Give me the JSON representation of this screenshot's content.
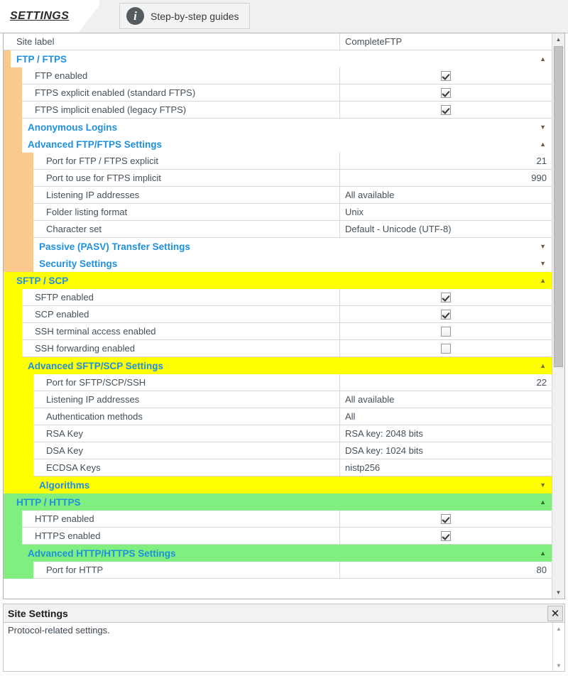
{
  "window": {
    "tab_label": "SETTINGS",
    "guides_button": "Step-by-step guides",
    "info_icon": "info-icon"
  },
  "grid": {
    "value_col_x": 474,
    "rows": [
      {
        "kind": "leaf",
        "indent": 0,
        "name": "Site label",
        "value": "CompleteFTP",
        "value_type": "text"
      },
      {
        "kind": "section",
        "level": 1,
        "color": "orange",
        "name": "FTP / FTPS",
        "expanded": true,
        "arrow": "▲"
      },
      {
        "kind": "leaf",
        "indent": 1,
        "name": "FTP enabled",
        "value_type": "checkbox",
        "checked": true
      },
      {
        "kind": "leaf",
        "indent": 1,
        "name": "FTPS explicit enabled (standard FTPS)",
        "value_type": "checkbox",
        "checked": true
      },
      {
        "kind": "leaf",
        "indent": 1,
        "name": "FTPS implicit enabled (legacy FTPS)",
        "value_type": "checkbox",
        "checked": true
      },
      {
        "kind": "section",
        "level": 2,
        "color": "orange",
        "name": "Anonymous Logins",
        "expanded": false,
        "arrow": "▼"
      },
      {
        "kind": "section",
        "level": 2,
        "color": "orange",
        "name": "Advanced FTP/FTPS Settings",
        "expanded": true,
        "arrow": "▲"
      },
      {
        "kind": "leaf",
        "indent": 2,
        "name": "Port for FTP / FTPS explicit",
        "value": "21",
        "value_type": "number"
      },
      {
        "kind": "leaf",
        "indent": 2,
        "name": "Port to use for FTPS implicit",
        "value": "990",
        "value_type": "number"
      },
      {
        "kind": "leaf",
        "indent": 2,
        "name": "Listening IP addresses",
        "value": "All available",
        "value_type": "text"
      },
      {
        "kind": "leaf",
        "indent": 2,
        "name": "Folder listing format",
        "value": "Unix",
        "value_type": "text"
      },
      {
        "kind": "leaf",
        "indent": 2,
        "name": "Character set",
        "value": "Default - Unicode (UTF-8)",
        "value_type": "text"
      },
      {
        "kind": "section",
        "level": 3,
        "color": "orange",
        "name": "Passive (PASV) Transfer Settings",
        "expanded": false,
        "arrow": "▼"
      },
      {
        "kind": "section",
        "level": 3,
        "color": "orange",
        "name": "Security Settings",
        "expanded": false,
        "arrow": "▼"
      },
      {
        "kind": "section",
        "level": 1,
        "color": "yellow",
        "name": "SFTP / SCP",
        "expanded": true,
        "arrow": "▲"
      },
      {
        "kind": "leaf",
        "indent": 1,
        "name": "SFTP enabled",
        "value_type": "checkbox",
        "checked": true
      },
      {
        "kind": "leaf",
        "indent": 1,
        "name": "SCP enabled",
        "value_type": "checkbox",
        "checked": true
      },
      {
        "kind": "leaf",
        "indent": 1,
        "name": "SSH terminal access enabled",
        "value_type": "checkbox",
        "checked": false
      },
      {
        "kind": "leaf",
        "indent": 1,
        "name": "SSH forwarding enabled",
        "value_type": "checkbox",
        "checked": false
      },
      {
        "kind": "section",
        "level": 2,
        "color": "yellow",
        "name": "Advanced SFTP/SCP Settings",
        "expanded": true,
        "arrow": "▲"
      },
      {
        "kind": "leaf",
        "indent": 2,
        "name": "Port for SFTP/SCP/SSH",
        "value": "22",
        "value_type": "number"
      },
      {
        "kind": "leaf",
        "indent": 2,
        "name": "Listening IP addresses",
        "value": "All available",
        "value_type": "text"
      },
      {
        "kind": "leaf",
        "indent": 2,
        "name": "Authentication methods",
        "value": "All",
        "value_type": "text"
      },
      {
        "kind": "leaf",
        "indent": 2,
        "name": "RSA Key",
        "value": "RSA key: 2048 bits",
        "value_type": "text"
      },
      {
        "kind": "leaf",
        "indent": 2,
        "name": "DSA Key",
        "value": "DSA key: 1024 bits",
        "value_type": "text"
      },
      {
        "kind": "leaf",
        "indent": 2,
        "name": "ECDSA Keys",
        "value": "nistp256",
        "value_type": "text"
      },
      {
        "kind": "section",
        "level": 3,
        "color": "yellow",
        "name": "Algorithms",
        "expanded": false,
        "arrow": "▼"
      },
      {
        "kind": "section",
        "level": 1,
        "color": "green",
        "name": "HTTP / HTTPS",
        "expanded": true,
        "arrow": "▲"
      },
      {
        "kind": "leaf",
        "indent": 1,
        "name": "HTTP enabled",
        "value_type": "checkbox",
        "checked": true
      },
      {
        "kind": "leaf",
        "indent": 1,
        "name": "HTTPS enabled",
        "value_type": "checkbox",
        "checked": true
      },
      {
        "kind": "section",
        "level": 2,
        "color": "green",
        "name": "Advanced HTTP/HTTPS Settings",
        "expanded": true,
        "arrow": "▲"
      },
      {
        "kind": "leaf",
        "indent": 2,
        "name": "Port for HTTP",
        "value": "80",
        "value_type": "number"
      }
    ]
  },
  "scrollbar": {
    "up_arrow": "▲",
    "down_arrow": "▼"
  },
  "help": {
    "title": "Site Settings",
    "close_label": "✕",
    "text": "Protocol-related settings.",
    "up_arrow": "▲",
    "down_arrow": "▼"
  },
  "colors": {
    "ftp": "#fbc88d",
    "sftp": "#ffff00",
    "http": "#7ff07f",
    "section_text": "#1e90dd",
    "body_text": "#45505a"
  }
}
